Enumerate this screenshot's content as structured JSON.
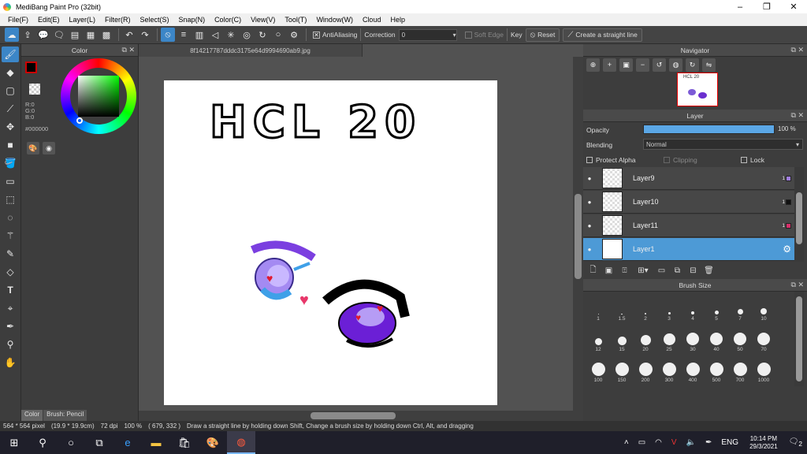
{
  "window": {
    "title": "MediBang Paint Pro (32bit)",
    "minimize": "–",
    "maximize": "❐",
    "close": "✕"
  },
  "menu": [
    "File(F)",
    "Edit(E)",
    "Layer(L)",
    "Filter(R)",
    "Select(S)",
    "Snap(N)",
    "Color(C)",
    "View(V)",
    "Tool(T)",
    "Window(W)",
    "Cloud",
    "Help"
  ],
  "toolbar": {
    "antialiasing": "AntiAliasing",
    "correction_label": "Correction",
    "correction_value": "0",
    "soft_edge": "Soft Edge",
    "key_label": "Key",
    "reset": "Reset",
    "straight_line": "Create a straight line"
  },
  "color_panel": {
    "title": "Color",
    "r": "R:0",
    "g": "G:0",
    "b": "B:0",
    "hex": "#000000",
    "tab_color": "Color",
    "tab_brush": "Brush: Pencil"
  },
  "document": {
    "tab": "8f14217787dddc3175e64d9994690ab9.jpg",
    "drawn_text": "HCL 20"
  },
  "navigator": {
    "title": "Navigator",
    "thumb_text": "HCL 20"
  },
  "layer_panel": {
    "title": "Layer",
    "opacity_label": "Opacity",
    "opacity_value": "100 %",
    "opacity_fraction": 1.0,
    "blending_label": "Blending",
    "blending_value": "Normal",
    "protect_alpha": "Protect Alpha",
    "clipping": "Clipping",
    "lock": "Lock",
    "layers": [
      {
        "name": "Layer9",
        "num": "1",
        "color": "#a07de0"
      },
      {
        "name": "Layer10",
        "num": "1",
        "color": "#111111"
      },
      {
        "name": "Layer11",
        "num": "1",
        "color": "#d6306a"
      },
      {
        "name": "Layer1",
        "num": "",
        "color": ""
      }
    ]
  },
  "brush_panel": {
    "title": "Brush Size",
    "sizes": [
      "1",
      "1.5",
      "2",
      "3",
      "4",
      "5",
      "7",
      "10",
      "12",
      "15",
      "20",
      "25",
      "30",
      "40",
      "50",
      "70",
      "100",
      "150",
      "200",
      "300",
      "400",
      "500",
      "700",
      "1000"
    ]
  },
  "status": {
    "size": "564 * 564 pixel",
    "physical": "(19.9 * 19.9cm)",
    "dpi": "72 dpi",
    "zoom": "100 %",
    "coords": "( 679, 332 )",
    "hint": "Draw a straight line by holding down Shift, Change a brush size by holding down Ctrl, Alt, and dragging"
  },
  "taskbar": {
    "language": "ENG",
    "time": "10:14 PM",
    "date": "29/3/2021",
    "notifications": "2"
  }
}
